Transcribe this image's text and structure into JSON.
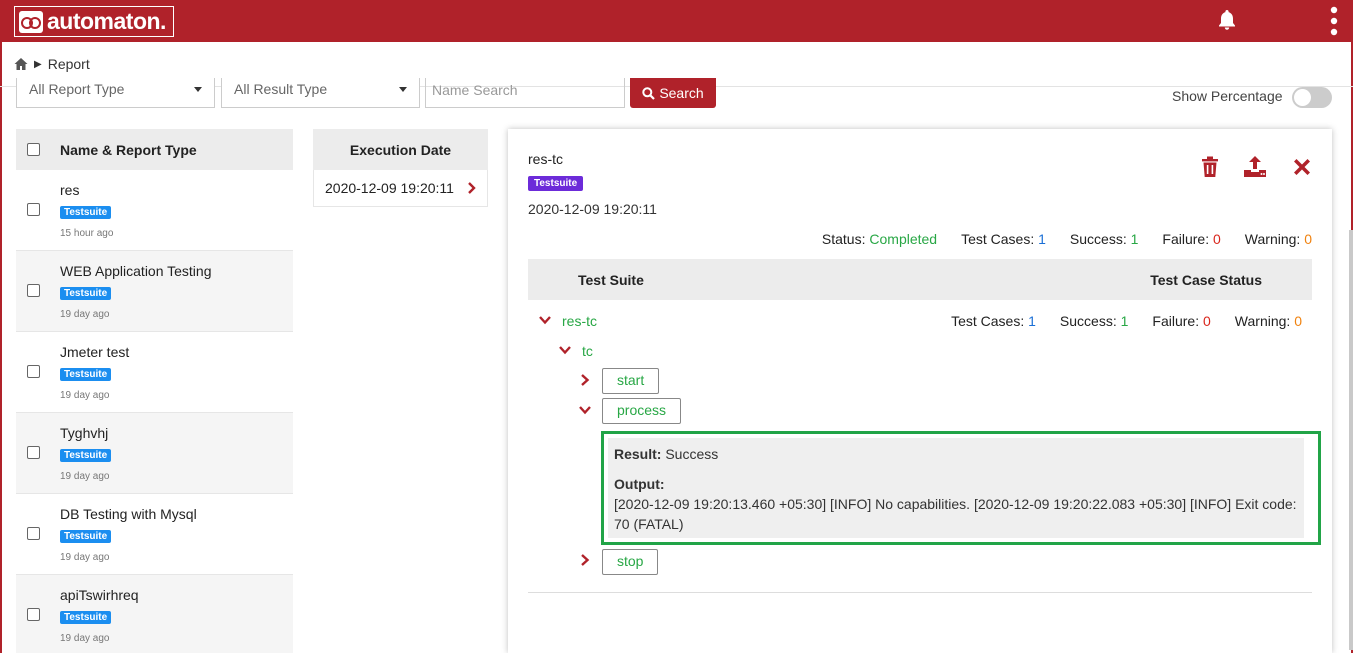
{
  "app": {
    "logo_text": "automaton.",
    "brand_color": "#b0222a"
  },
  "breadcrumb": {
    "current": "Report"
  },
  "filters": {
    "report_type": "All Report Type",
    "result_type": "All Result Type",
    "name_search_placeholder": "Name Search",
    "search_label": "Search",
    "show_percentage_label": "Show Percentage",
    "show_percentage_on": false
  },
  "report_list": {
    "header": "Name & Report Type",
    "items": [
      {
        "name": "res",
        "type": "Testsuite",
        "ago": "15 hour ago"
      },
      {
        "name": "WEB Application Testing",
        "type": "Testsuite",
        "ago": "19 day ago"
      },
      {
        "name": "Jmeter test",
        "type": "Testsuite",
        "ago": "19 day ago"
      },
      {
        "name": "Tyghvhj",
        "type": "Testsuite",
        "ago": "19 day ago"
      },
      {
        "name": "DB Testing with Mysql",
        "type": "Testsuite",
        "ago": "19 day ago"
      },
      {
        "name": "apiTswirhreq",
        "type": "Testsuite",
        "ago": "19 day ago"
      }
    ]
  },
  "execution": {
    "header": "Execution Date",
    "rows": [
      "2020-12-09 19:20:11"
    ]
  },
  "detail": {
    "title": "res-tc",
    "type": "Testsuite",
    "date": "2020-12-09 19:20:11",
    "summary": {
      "status_label": "Status:",
      "status_value": "Completed",
      "test_cases_label": "Test Cases:",
      "test_cases_value": "1",
      "success_label": "Success:",
      "success_value": "1",
      "failure_label": "Failure:",
      "failure_value": "0",
      "warning_label": "Warning:",
      "warning_value": "0"
    },
    "table_headers": {
      "suite": "Test Suite",
      "status": "Test Case Status"
    },
    "tree": {
      "suite_name": "res-tc",
      "test_cases_label": "Test Cases:",
      "test_cases_value": "1",
      "success_label": "Success:",
      "success_value": "1",
      "failure_label": "Failure:",
      "failure_value": "0",
      "warning_label": "Warning:",
      "warning_value": "0",
      "case_name": "tc",
      "steps": [
        "start",
        "process",
        "stop"
      ]
    },
    "result": {
      "result_label": "Result:",
      "result_value": "Success",
      "output_label": "Output:",
      "output_text": "[2020-12-09 19:20:13.460 +05:30] [INFO] No capabilities. [2020-12-09 19:20:22.083 +05:30] [INFO] Exit code: 70 (FATAL)"
    }
  }
}
